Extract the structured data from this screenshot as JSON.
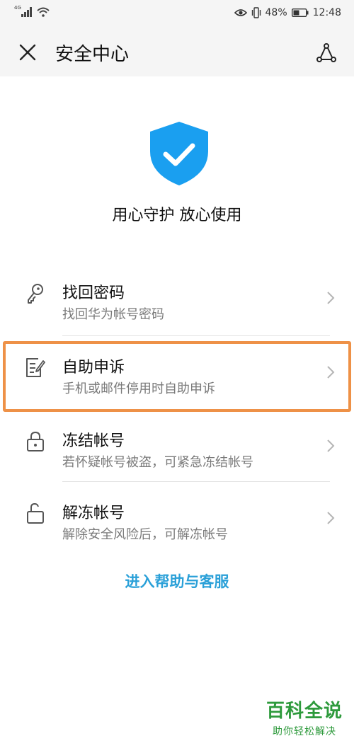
{
  "status_bar": {
    "network": "4G",
    "battery": "48%",
    "time": "12:48"
  },
  "toolbar": {
    "title": "安全中心"
  },
  "hero": {
    "slogan": "用心守护 放心使用"
  },
  "items": [
    {
      "title": "找回密码",
      "subtitle": "找回华为帐号密码",
      "icon": "key-icon"
    },
    {
      "title": "自助申诉",
      "subtitle": "手机或邮件停用时自助申诉",
      "icon": "edit-note-icon"
    },
    {
      "title": "冻结帐号",
      "subtitle": "若怀疑帐号被盗，可紧急冻结帐号",
      "icon": "lock-icon"
    },
    {
      "title": "解冻帐号",
      "subtitle": "解除安全风险后，可解冻帐号",
      "icon": "unlock-icon"
    }
  ],
  "help_link": "进入帮助与客服",
  "watermark": {
    "main": "百科全说",
    "sub": "助你轻松解决"
  },
  "colors": {
    "accent": "#2aa0d8",
    "shield": "#1a9ff0",
    "highlight": "#ee9147",
    "watermark": "#2e9a3c"
  }
}
